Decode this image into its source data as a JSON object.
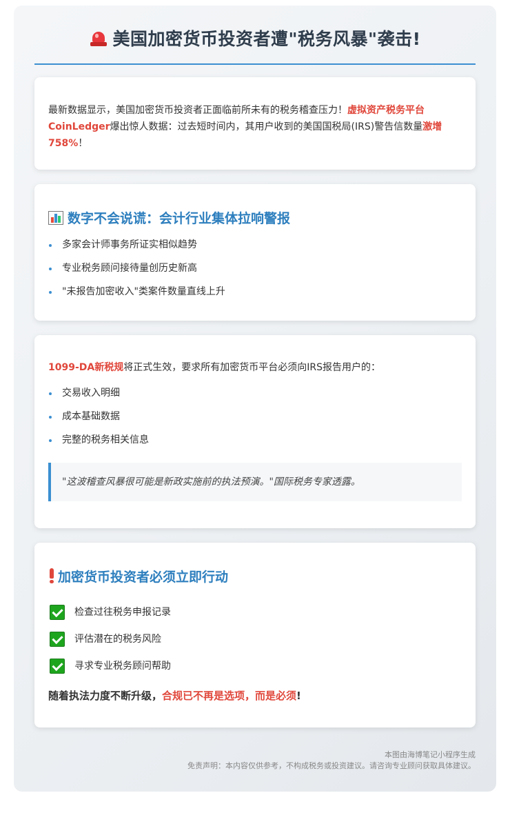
{
  "header": {
    "title": "美国加密货币投资者遭\"税务风暴\"袭击!"
  },
  "intro": {
    "text_before": "最新数据显示，美国加密货币投资者正面临前所未有的税务稽查压力！",
    "highlight1": "虚拟资产税务平台CoinLedger",
    "text_middle": "爆出惊人数据：过去短时间内，其用户收到的美国国税局(IRS)警告信数量",
    "highlight2": "激增758%",
    "text_after": "！"
  },
  "stats_section": {
    "title": "数字不会说谎：会计行业集体拉响警报",
    "items": [
      "多家会计师事务所证实相似趋势",
      "专业税务顾问接待量创历史新高",
      "\"未报告加密收入\"类案件数量直线上升"
    ]
  },
  "rule_section": {
    "rule_name": "1099-DA新税规",
    "text": "将正式生效，要求所有加密货币平台必须向IRS报告用户的：",
    "items": [
      "交易收入明细",
      "成本基础数据",
      "完整的税务相关信息"
    ],
    "quote": "\"这波稽查风暴很可能是新政实施前的执法预演。\"国际税务专家透露。"
  },
  "action_section": {
    "title": "加密货币投资者必须立即行动",
    "items": [
      "检查过往税务申报记录",
      "评估潜在的税务风险",
      "寻求专业税务顾问帮助"
    ],
    "conclusion_prefix": "随着执法力度不断升级，",
    "conclusion_highlight": "合规已不再是选项，而是必须",
    "conclusion_suffix": "!"
  },
  "footer": {
    "line1": "本图由海博笔记小程序生成",
    "line2": "免责声明：本内容仅供参考，不构成税务或投资建议。请咨询专业顾问获取具体建议。"
  },
  "colors": {
    "accent_blue": "#3b8fd1",
    "title_blue": "#2e7fbe",
    "highlight_red": "#e0473b",
    "check_green": "#1ea51e"
  },
  "icons": {
    "header": "siren-icon",
    "stats": "bar-chart-icon",
    "action": "exclamation-icon",
    "checklist": "check-mark-icon"
  }
}
